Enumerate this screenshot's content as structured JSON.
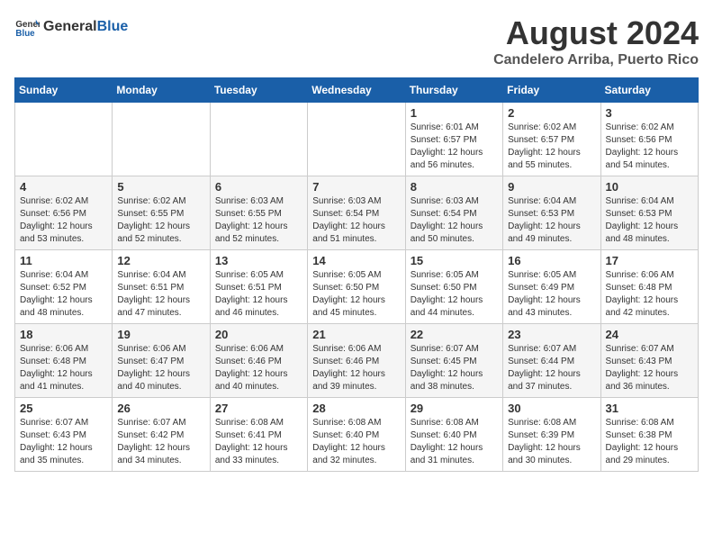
{
  "header": {
    "logo_general": "General",
    "logo_blue": "Blue",
    "main_title": "August 2024",
    "sub_title": "Candelero Arriba, Puerto Rico"
  },
  "calendar": {
    "days_of_week": [
      "Sunday",
      "Monday",
      "Tuesday",
      "Wednesday",
      "Thursday",
      "Friday",
      "Saturday"
    ],
    "weeks": [
      [
        {
          "day": "",
          "info": ""
        },
        {
          "day": "",
          "info": ""
        },
        {
          "day": "",
          "info": ""
        },
        {
          "day": "",
          "info": ""
        },
        {
          "day": "1",
          "info": "Sunrise: 6:01 AM\nSunset: 6:57 PM\nDaylight: 12 hours\nand 56 minutes."
        },
        {
          "day": "2",
          "info": "Sunrise: 6:02 AM\nSunset: 6:57 PM\nDaylight: 12 hours\nand 55 minutes."
        },
        {
          "day": "3",
          "info": "Sunrise: 6:02 AM\nSunset: 6:56 PM\nDaylight: 12 hours\nand 54 minutes."
        }
      ],
      [
        {
          "day": "4",
          "info": "Sunrise: 6:02 AM\nSunset: 6:56 PM\nDaylight: 12 hours\nand 53 minutes."
        },
        {
          "day": "5",
          "info": "Sunrise: 6:02 AM\nSunset: 6:55 PM\nDaylight: 12 hours\nand 52 minutes."
        },
        {
          "day": "6",
          "info": "Sunrise: 6:03 AM\nSunset: 6:55 PM\nDaylight: 12 hours\nand 52 minutes."
        },
        {
          "day": "7",
          "info": "Sunrise: 6:03 AM\nSunset: 6:54 PM\nDaylight: 12 hours\nand 51 minutes."
        },
        {
          "day": "8",
          "info": "Sunrise: 6:03 AM\nSunset: 6:54 PM\nDaylight: 12 hours\nand 50 minutes."
        },
        {
          "day": "9",
          "info": "Sunrise: 6:04 AM\nSunset: 6:53 PM\nDaylight: 12 hours\nand 49 minutes."
        },
        {
          "day": "10",
          "info": "Sunrise: 6:04 AM\nSunset: 6:53 PM\nDaylight: 12 hours\nand 48 minutes."
        }
      ],
      [
        {
          "day": "11",
          "info": "Sunrise: 6:04 AM\nSunset: 6:52 PM\nDaylight: 12 hours\nand 48 minutes."
        },
        {
          "day": "12",
          "info": "Sunrise: 6:04 AM\nSunset: 6:51 PM\nDaylight: 12 hours\nand 47 minutes."
        },
        {
          "day": "13",
          "info": "Sunrise: 6:05 AM\nSunset: 6:51 PM\nDaylight: 12 hours\nand 46 minutes."
        },
        {
          "day": "14",
          "info": "Sunrise: 6:05 AM\nSunset: 6:50 PM\nDaylight: 12 hours\nand 45 minutes."
        },
        {
          "day": "15",
          "info": "Sunrise: 6:05 AM\nSunset: 6:50 PM\nDaylight: 12 hours\nand 44 minutes."
        },
        {
          "day": "16",
          "info": "Sunrise: 6:05 AM\nSunset: 6:49 PM\nDaylight: 12 hours\nand 43 minutes."
        },
        {
          "day": "17",
          "info": "Sunrise: 6:06 AM\nSunset: 6:48 PM\nDaylight: 12 hours\nand 42 minutes."
        }
      ],
      [
        {
          "day": "18",
          "info": "Sunrise: 6:06 AM\nSunset: 6:48 PM\nDaylight: 12 hours\nand 41 minutes."
        },
        {
          "day": "19",
          "info": "Sunrise: 6:06 AM\nSunset: 6:47 PM\nDaylight: 12 hours\nand 40 minutes."
        },
        {
          "day": "20",
          "info": "Sunrise: 6:06 AM\nSunset: 6:46 PM\nDaylight: 12 hours\nand 40 minutes."
        },
        {
          "day": "21",
          "info": "Sunrise: 6:06 AM\nSunset: 6:46 PM\nDaylight: 12 hours\nand 39 minutes."
        },
        {
          "day": "22",
          "info": "Sunrise: 6:07 AM\nSunset: 6:45 PM\nDaylight: 12 hours\nand 38 minutes."
        },
        {
          "day": "23",
          "info": "Sunrise: 6:07 AM\nSunset: 6:44 PM\nDaylight: 12 hours\nand 37 minutes."
        },
        {
          "day": "24",
          "info": "Sunrise: 6:07 AM\nSunset: 6:43 PM\nDaylight: 12 hours\nand 36 minutes."
        }
      ],
      [
        {
          "day": "25",
          "info": "Sunrise: 6:07 AM\nSunset: 6:43 PM\nDaylight: 12 hours\nand 35 minutes."
        },
        {
          "day": "26",
          "info": "Sunrise: 6:07 AM\nSunset: 6:42 PM\nDaylight: 12 hours\nand 34 minutes."
        },
        {
          "day": "27",
          "info": "Sunrise: 6:08 AM\nSunset: 6:41 PM\nDaylight: 12 hours\nand 33 minutes."
        },
        {
          "day": "28",
          "info": "Sunrise: 6:08 AM\nSunset: 6:40 PM\nDaylight: 12 hours\nand 32 minutes."
        },
        {
          "day": "29",
          "info": "Sunrise: 6:08 AM\nSunset: 6:40 PM\nDaylight: 12 hours\nand 31 minutes."
        },
        {
          "day": "30",
          "info": "Sunrise: 6:08 AM\nSunset: 6:39 PM\nDaylight: 12 hours\nand 30 minutes."
        },
        {
          "day": "31",
          "info": "Sunrise: 6:08 AM\nSunset: 6:38 PM\nDaylight: 12 hours\nand 29 minutes."
        }
      ]
    ]
  }
}
